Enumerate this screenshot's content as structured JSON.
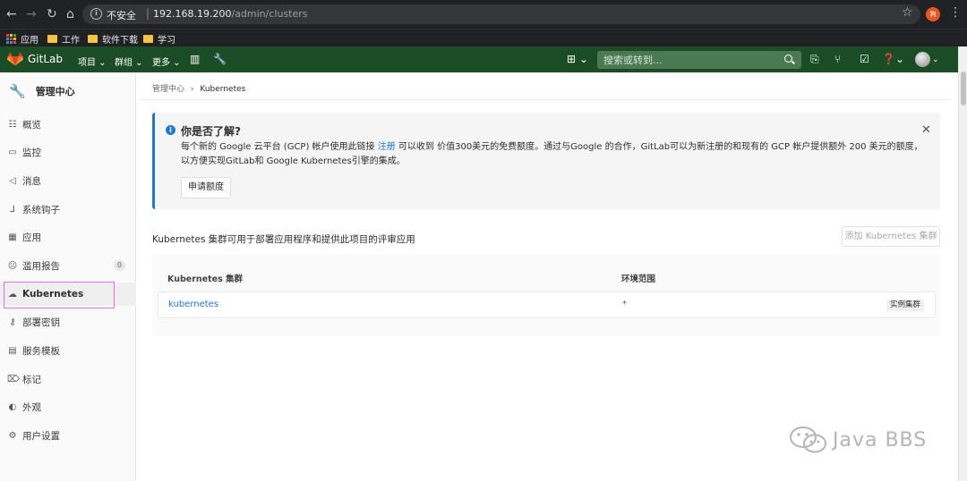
{
  "browser": {
    "insecure_label": "不安全",
    "separator": "|",
    "url_host": "192.168.19.200",
    "url_path": "/admin/clusters",
    "profile_initial": "狗",
    "bookmarks": [
      {
        "label": "应用"
      },
      {
        "label": "工作"
      },
      {
        "label": "软件下载"
      },
      {
        "label": "学习"
      }
    ]
  },
  "header": {
    "brand": "GitLab",
    "nav": [
      {
        "label": "项目 ⌄"
      },
      {
        "label": "群组 ⌄"
      },
      {
        "label": "更多 ⌄"
      }
    ],
    "search_placeholder": "搜索或转到..."
  },
  "sidebar": {
    "title": "管理中心",
    "items": [
      {
        "label": "概览"
      },
      {
        "label": "监控"
      },
      {
        "label": "消息"
      },
      {
        "label": "系统钩子"
      },
      {
        "label": "应用"
      },
      {
        "label": "滥用报告",
        "badge": "0"
      },
      {
        "label": "Kubernetes"
      },
      {
        "label": "部署密钥"
      },
      {
        "label": "服务模板"
      },
      {
        "label": "标记"
      },
      {
        "label": "外观"
      },
      {
        "label": "用户设置"
      }
    ]
  },
  "breadcrumb": {
    "parent": "管理中心",
    "sep": "›",
    "current": "Kubernetes"
  },
  "alert": {
    "title": "你是否了解?",
    "body_pre": "每个新的 Google 云平台 (GCP) 帐户使用此链接 ",
    "body_link": "注册",
    "body_post": " 可以收到 价值300美元的免费额度。通过与Google 的合作，GitLab可以为新注册的和现有的 GCP 帐户提供额外 200 美元的额度，以方便实现GitLab和 Google Kubernetes引擎的集成。",
    "button": "申请额度",
    "close": "✕"
  },
  "main": {
    "description": "Kubernetes 集群可用于部署应用程序和提供此项目的评审应用",
    "add_button": "添加 Kubernetes 集群",
    "table": {
      "headers": [
        "Kubernetes 集群",
        "环境范围"
      ],
      "rows": [
        {
          "name": "kubernetes",
          "scope": "*",
          "tag": "实例集群"
        }
      ]
    }
  },
  "watermark": "Java BBS",
  "colors": {
    "header_green": "#1a4d25",
    "link_blue": "#1f78d1",
    "highlight_pink": "#e56ef0"
  }
}
